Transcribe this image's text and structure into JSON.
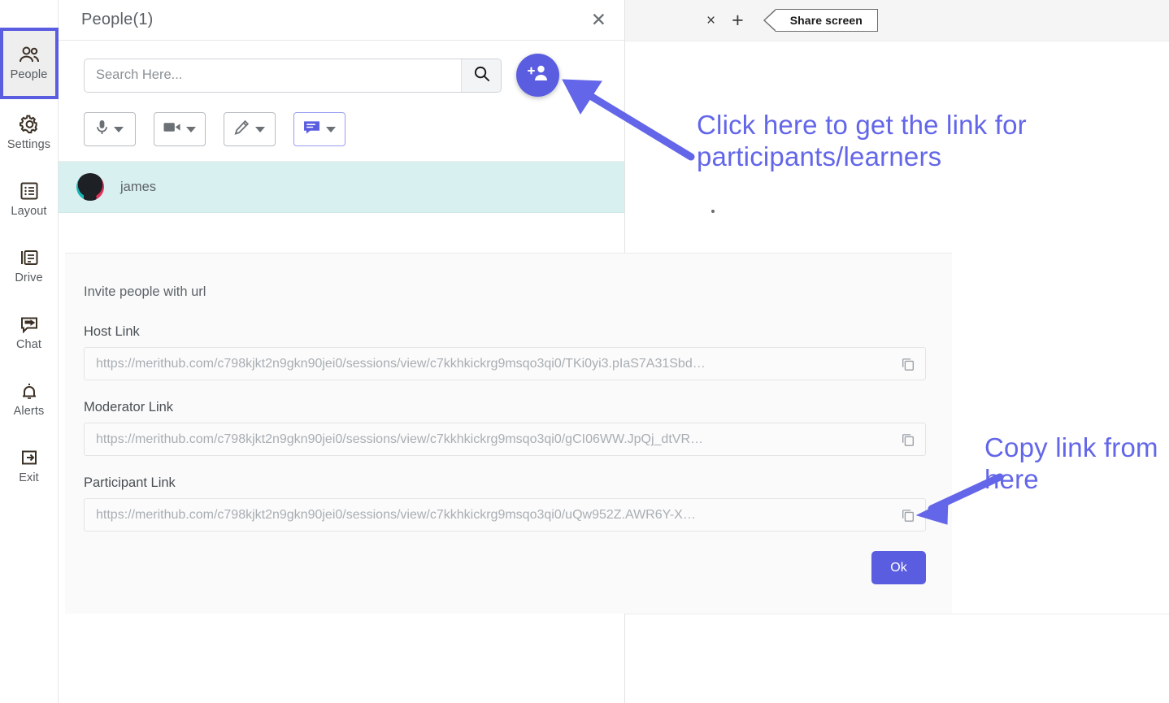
{
  "sidebar": {
    "items": [
      {
        "label": "People",
        "icon": "people-icon",
        "active": true
      },
      {
        "label": "Settings",
        "icon": "gear-icon",
        "active": false
      },
      {
        "label": "Layout",
        "icon": "layout-icon",
        "active": false
      },
      {
        "label": "Drive",
        "icon": "drive-icon",
        "active": false
      },
      {
        "label": "Chat",
        "icon": "chat-icon",
        "active": false
      },
      {
        "label": "Alerts",
        "icon": "bell-icon",
        "active": false
      },
      {
        "label": "Exit",
        "icon": "exit-icon",
        "active": false
      }
    ]
  },
  "people_panel": {
    "title": "People(1)",
    "close_label": "✕",
    "search": {
      "placeholder": "Search Here...",
      "value": ""
    },
    "toolbar": [
      {
        "name": "microphone",
        "icon": "microphone-icon",
        "active": false
      },
      {
        "name": "camera",
        "icon": "video-camera-icon",
        "active": false
      },
      {
        "name": "whiteboard",
        "icon": "pencil-icon",
        "active": false
      },
      {
        "name": "chat",
        "icon": "chat-bubble-icon",
        "active": true
      }
    ],
    "participants": [
      {
        "name": "james"
      }
    ]
  },
  "modal": {
    "heading": "Invite people with url",
    "fields": [
      {
        "label": "Host Link",
        "url": "https://merithub.com/c798kjkt2n9gkn90jei0/sessions/view/c7kkhkickrg9msqo3qi0/TKi0yi3.pIaS7A31Sbd…"
      },
      {
        "label": "Moderator Link",
        "url": "https://merithub.com/c798kjkt2n9gkn90jei0/sessions/view/c7kkhkickrg9msqo3qi0/gCI06WW.JpQj_dtVR…"
      },
      {
        "label": "Participant Link",
        "url": "https://merithub.com/c798kjkt2n9gkn90jei0/sessions/view/c7kkhkickrg9msqo3qi0/uQw952Z.AWR6Y-X…"
      }
    ],
    "ok_label": "Ok"
  },
  "stage": {
    "tab_close_label": "×",
    "tab_add_label": "+",
    "share_screen_label": "Share screen"
  },
  "annotations": {
    "top": "Click here to get the link for participants/learners",
    "bottom": "Copy link from here"
  },
  "colors": {
    "accent": "#5a5de0",
    "annotation": "#6366e8",
    "participant_row": "#d9f0f0"
  }
}
